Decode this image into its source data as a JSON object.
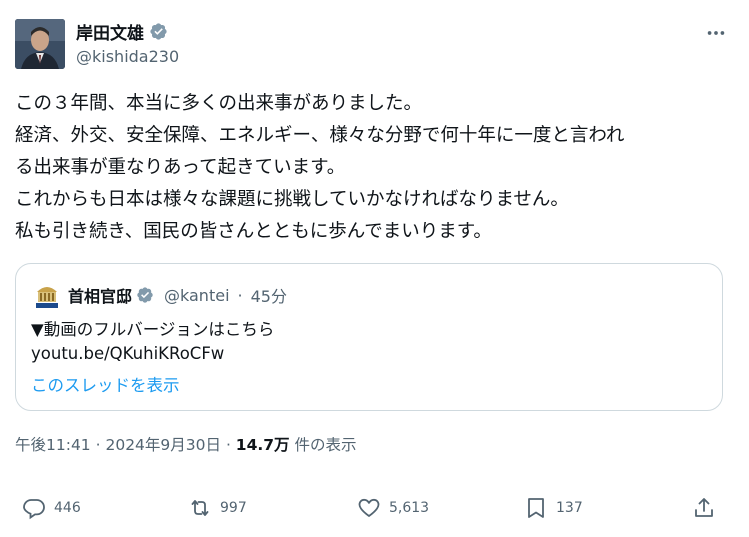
{
  "author": {
    "name": "岸田文雄",
    "handle": "@kishida230",
    "verified_color": "#829aab"
  },
  "more_icon": "more-horizontal-icon",
  "tweet_lines": [
    "この３年間、本当に多くの出来事がありました。",
    "経済、外交、安全保障、エネルギー、様々な分野で何十年に一度と言われ",
    "る出来事が重なりあって起きています。",
    "これからも日本は様々な課題に挑戦していかなければなりません。",
    "私も引き続き、国民の皆さんとともに歩んでまいります。"
  ],
  "quote": {
    "name": "首相官邸",
    "handle": "@kantei",
    "time": "45分",
    "line1": "▼動画のフルバージョンはこちら",
    "line2": "youtu.be/QKuhiKRoCFw",
    "show_thread": "このスレッドを表示"
  },
  "timestamp": {
    "time": "午後11:41",
    "date": "2024年9月30日",
    "views": "14.7万",
    "views_suffix": "件の表示"
  },
  "actions": {
    "replies": "446",
    "reposts": "997",
    "likes": "5,613",
    "bookmarks": "137"
  },
  "colors": {
    "link": "#1d9bf0",
    "secondary_text": "#536471",
    "border": "#cfd9de"
  }
}
